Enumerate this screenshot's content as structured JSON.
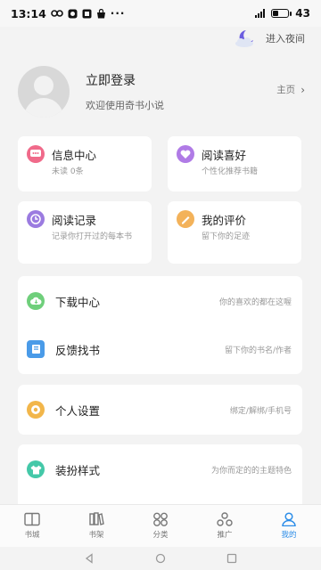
{
  "status": {
    "time": "13:14",
    "battery_pct": 43,
    "battery_label": "43"
  },
  "night_mode": {
    "label": "进入夜间"
  },
  "profile": {
    "login": "立即登录",
    "welcome": "欢迎使用奇书小说",
    "home": "主页"
  },
  "grid": [
    {
      "title": "信息中心",
      "sub": "未读 0条",
      "icon": "message-icon",
      "color": "#f06a8a"
    },
    {
      "title": "阅读喜好",
      "sub": "个性化推荐书籍",
      "icon": "heart-icon",
      "color": "#b07be6"
    },
    {
      "title": "阅读记录",
      "sub": "记录你打开过的每本书",
      "icon": "clock-icon",
      "color": "#9b7be0"
    },
    {
      "title": "我的评价",
      "sub": "留下你的足迹",
      "icon": "comment-icon",
      "color": "#f3b25a"
    }
  ],
  "list_group1": [
    {
      "title": "下载中心",
      "desc": "你的喜欢的都在这喔",
      "icon": "cloud-download-icon",
      "color": "#6fcf7b"
    },
    {
      "title": "反馈找书",
      "desc": "留下你的书名/作者",
      "icon": "book-feedback-icon",
      "color": "#4a9be8"
    }
  ],
  "settings": {
    "title": "个人设置",
    "desc": "绑定/解绑/手机号",
    "icon": "settings-icon",
    "color": "#f2b64a"
  },
  "theme": {
    "title": "装扮样式",
    "desc": "为你而定的的主题特色",
    "icon": "shirt-icon",
    "color": "#44c8a8"
  },
  "tabs": [
    {
      "label": "书城",
      "icon": "bookstore-icon"
    },
    {
      "label": "书架",
      "icon": "bookshelf-icon"
    },
    {
      "label": "分类",
      "icon": "category-icon"
    },
    {
      "label": "推广",
      "icon": "promote-icon"
    },
    {
      "label": "我的",
      "icon": "profile-icon",
      "active": true
    }
  ],
  "colors": {
    "accent": "#2c8de8",
    "background": "#f3f3f3"
  }
}
